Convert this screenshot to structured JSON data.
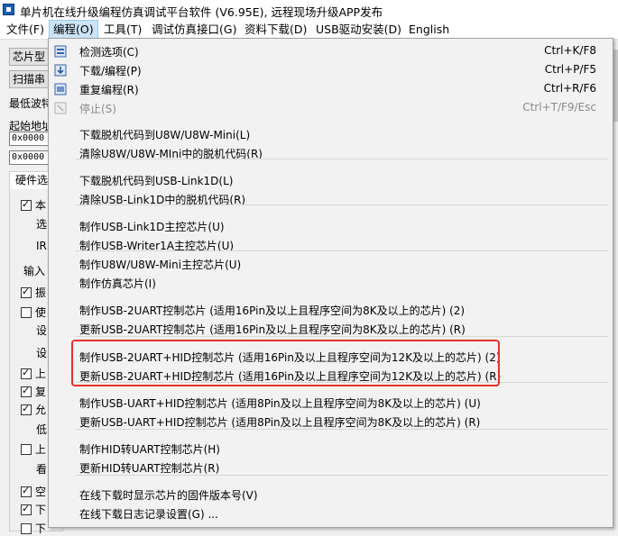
{
  "window": {
    "title": "单片机在线升级编程仿真调试平台软件 (V6.95E), 远程现场升级APP发布"
  },
  "menubar": [
    {
      "label": "文件(F)",
      "active": false
    },
    {
      "label": "编程(O)",
      "active": true
    },
    {
      "label": "工具(T)",
      "active": false
    },
    {
      "label": "调试仿真接口(G)",
      "active": false
    },
    {
      "label": "资料下载(D)",
      "active": false
    },
    {
      "label": "USB驱动安装(D)",
      "active": false
    },
    {
      "label": "English",
      "active": false
    }
  ],
  "background": {
    "chip_type_btn": "芯片型",
    "scan_btn": "扫描串",
    "min_baud": "最低波特",
    "start_addr": "起始地址",
    "addr1": "0x0000",
    "addr2": "0x0000",
    "hw_tab": "硬件选",
    "rows": [
      {
        "label": "本",
        "check": "on"
      },
      {
        "label": "选",
        "check": "none"
      },
      {
        "label": "IR",
        "check": "none"
      },
      {
        "label": "输入",
        "check": "none"
      },
      {
        "label": "振",
        "check": "on"
      },
      {
        "label": "使",
        "check": "off"
      },
      {
        "label": "设",
        "check": "none"
      },
      {
        "label": "设",
        "check": "none"
      },
      {
        "label": "上",
        "check": "on"
      },
      {
        "label": "复",
        "check": "on"
      },
      {
        "label": "允",
        "check": "on"
      },
      {
        "label": "低",
        "check": "none"
      },
      {
        "label": "上",
        "check": "off"
      },
      {
        "label": "看",
        "check": "none"
      },
      {
        "label": "空",
        "check": "on"
      },
      {
        "label": "下",
        "check": "on"
      },
      {
        "label": "下",
        "check": "off"
      }
    ]
  },
  "dropdown": {
    "items": [
      {
        "label": "检测选项(C)",
        "shortcut": "Ctrl+K/F8",
        "icon": "detect-icon",
        "disabled": false
      },
      {
        "label": "下载/编程(P)",
        "shortcut": "Ctrl+P/F5",
        "icon": "download-program-icon",
        "disabled": false
      },
      {
        "label": "重复编程(R)",
        "shortcut": "Ctrl+R/F6",
        "icon": "repeat-program-icon",
        "disabled": false
      },
      {
        "label": "停止(S)",
        "shortcut": "Ctrl+T/F9/Esc",
        "icon": "stop-icon",
        "disabled": true
      },
      {
        "label": "下载脱机代码到U8W/U8W-Mini(L)",
        "shortcut": "",
        "icon": "",
        "disabled": false
      },
      {
        "label": "清除U8W/U8W-MIni中的脱机代码(R)",
        "shortcut": "",
        "icon": "",
        "disabled": false
      },
      {
        "label": "下载脱机代码到USB-Link1D(L)",
        "shortcut": "",
        "icon": "",
        "disabled": false
      },
      {
        "label": "清除USB-Link1D中的脱机代码(R)",
        "shortcut": "",
        "icon": "",
        "disabled": false
      },
      {
        "label": "制作USB-Link1D主控芯片(U)",
        "shortcut": "",
        "icon": "",
        "disabled": false
      },
      {
        "label": "制作USB-Writer1A主控芯片(U)",
        "shortcut": "",
        "icon": "",
        "disabled": false
      },
      {
        "label": "制作U8W/U8W-Mini主控芯片(U)",
        "shortcut": "",
        "icon": "",
        "disabled": false
      },
      {
        "label": "制作仿真芯片(I)",
        "shortcut": "",
        "icon": "",
        "disabled": false
      },
      {
        "label": "制作USB-2UART控制芯片 (适用16Pin及以上且程序空间为8K及以上的芯片) (2)",
        "shortcut": "",
        "icon": "",
        "disabled": false
      },
      {
        "label": "更新USB-2UART控制芯片 (适用16Pin及以上且程序空间为8K及以上的芯片) (R)",
        "shortcut": "",
        "icon": "",
        "disabled": false
      },
      {
        "label": "制作USB-2UART+HID控制芯片 (适用16Pin及以上且程序空间为12K及以上的芯片) (2)",
        "shortcut": "",
        "icon": "",
        "disabled": false
      },
      {
        "label": "更新USB-2UART+HID控制芯片 (适用16Pin及以上且程序空间为12K及以上的芯片) (R)",
        "shortcut": "",
        "icon": "",
        "disabled": false
      },
      {
        "label": "制作USB-UART+HID控制芯片 (适用8Pin及以上且程序空间为8K及以上的芯片) (U)",
        "shortcut": "",
        "icon": "",
        "disabled": false
      },
      {
        "label": "更新USB-UART+HID控制芯片 (适用8Pin及以上且程序空间为8K及以上的芯片) (R)",
        "shortcut": "",
        "icon": "",
        "disabled": false
      },
      {
        "label": "制作HID转UART控制芯片(H)",
        "shortcut": "",
        "icon": "",
        "disabled": false
      },
      {
        "label": "更新HID转UART控制芯片(R)",
        "shortcut": "",
        "icon": "",
        "disabled": false
      },
      {
        "label": "在线下载时显示芯片的固件版本号(V)",
        "shortcut": "",
        "icon": "",
        "disabled": false
      },
      {
        "label": "在线下载日志记录设置(G) ...",
        "shortcut": "",
        "icon": "",
        "disabled": false
      }
    ]
  },
  "colors": {
    "highlight": "#e3322b",
    "menu_active": "#cce4f7"
  }
}
